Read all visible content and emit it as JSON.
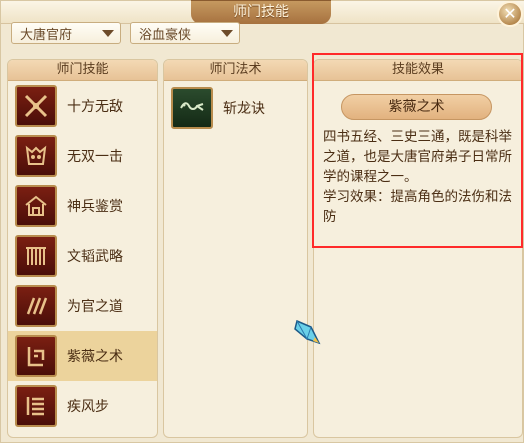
{
  "window": {
    "title": "师门技能",
    "close_icon": "close-icon"
  },
  "dropdowns": [
    {
      "value": "大唐官府"
    },
    {
      "value": "浴血豪侠"
    }
  ],
  "panels": {
    "skills_header": "师门技能",
    "spells_header": "师门法术",
    "effect_header": "技能效果"
  },
  "skills": [
    {
      "name": "十方无敌",
      "icon": "x-crossed-blades-icon"
    },
    {
      "name": "无双一击",
      "icon": "demon-mask-icon"
    },
    {
      "name": "神兵鉴赏",
      "icon": "house-weapon-icon"
    },
    {
      "name": "文韬武略",
      "icon": "gate-pillars-icon"
    },
    {
      "name": "为官之道",
      "icon": "tracks-icon"
    },
    {
      "name": "紫薇之术",
      "icon": "bracket-rune-icon",
      "selected": true
    },
    {
      "name": "疾风步",
      "icon": "scroll-rune-icon"
    }
  ],
  "spells": [
    {
      "name": "斩龙诀",
      "icon": "dragon-slash-icon"
    }
  ],
  "effect": {
    "title": "紫薇之术",
    "description": "四书五经、三史三通，既是科举之道，也是大唐官府弟子日常所学的课程之一。",
    "effect_line": "学习效果：提高角色的法伤和法防"
  },
  "colors": {
    "selection": "#ecd39c",
    "highlight_border": "#ff2a2a",
    "header_gradient_top": "#f3d9b4",
    "icon_bg": "#7b1f12"
  }
}
